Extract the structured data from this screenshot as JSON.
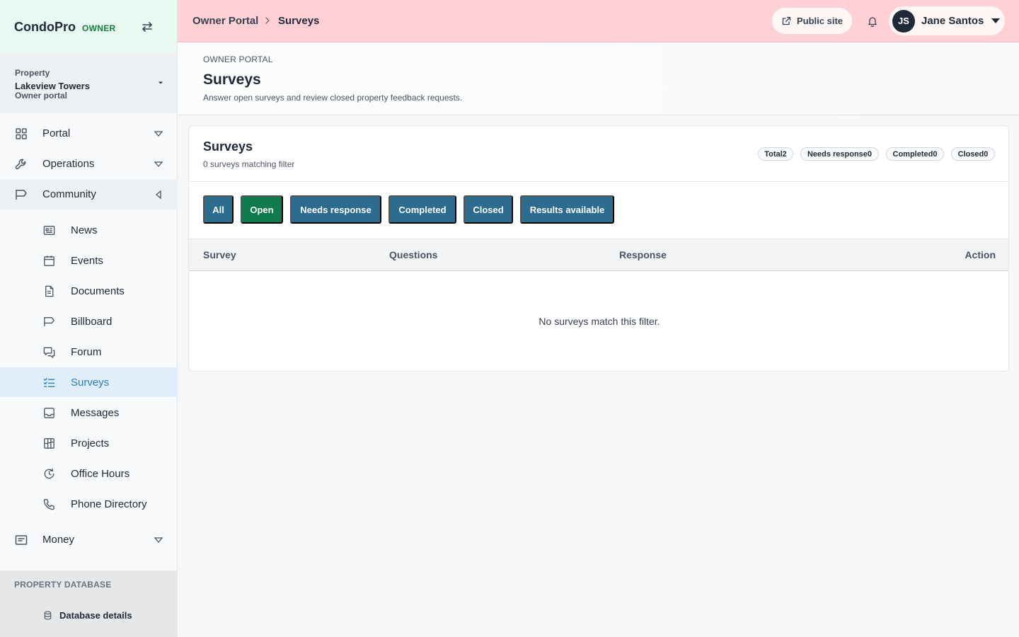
{
  "brand": {
    "name": "CondoPro",
    "role": "OWNER"
  },
  "property": {
    "label": "Property",
    "name": "Lakeview Towers",
    "sub": "Owner portal"
  },
  "nav": {
    "groups": [
      {
        "label": "Portal"
      },
      {
        "label": "Operations"
      },
      {
        "label": "Community"
      },
      {
        "label": "Money"
      }
    ],
    "community_items": [
      {
        "label": "News"
      },
      {
        "label": "Events"
      },
      {
        "label": "Documents"
      },
      {
        "label": "Billboard"
      },
      {
        "label": "Forum"
      },
      {
        "label": "Surveys"
      },
      {
        "label": "Messages"
      },
      {
        "label": "Projects"
      },
      {
        "label": "Office Hours"
      },
      {
        "label": "Phone Directory"
      }
    ],
    "active_item": "Surveys"
  },
  "db_section": {
    "title": "PROPERTY DATABASE",
    "item": "Database details"
  },
  "header": {
    "breadcrumb": [
      "Owner Portal",
      "Surveys"
    ],
    "public_site": "Public site",
    "user": {
      "initials": "JS",
      "name": "Jane Santos"
    }
  },
  "page": {
    "eyebrow": "OWNER PORTAL",
    "title": "Surveys",
    "description": "Answer open surveys and review closed property feedback requests."
  },
  "card": {
    "title": "Surveys",
    "subtitle": "0 surveys matching filter",
    "stats": [
      "Total2",
      "Needs response0",
      "Completed0",
      "Closed0"
    ],
    "filters": [
      "All",
      "Open",
      "Needs response",
      "Completed",
      "Closed",
      "Results available"
    ],
    "active_filter": "Open",
    "columns": [
      "Survey",
      "Questions",
      "Response",
      "Action"
    ],
    "empty_message": "No surveys match this filter."
  },
  "colors": {
    "accent": "#2a7dc1",
    "filter": "#2b6c8f",
    "filter_active": "#0f7a4c",
    "header_bg": "#ffd0d4",
    "brand_bg": "#e9f8f0"
  }
}
